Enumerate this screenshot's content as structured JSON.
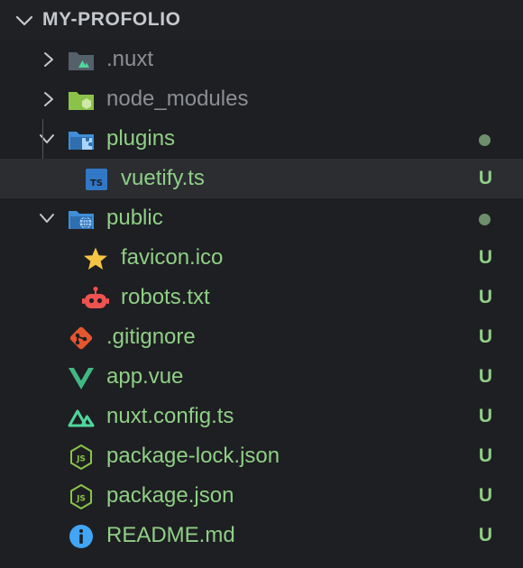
{
  "explorer": {
    "section_title": "MY-PROFOLIO"
  },
  "colors": {
    "background": "#1e1f22",
    "untracked_green": "#8fcf86",
    "ignored_gray": "#8b8e93",
    "selected_row": "#2b2d31"
  },
  "tree": {
    "items": [
      {
        "label": ".nuxt",
        "type": "folder",
        "expanded": false,
        "icon": "nuxt-folder-icon",
        "status": ""
      },
      {
        "label": "node_modules",
        "type": "folder",
        "expanded": false,
        "icon": "node-folder-icon",
        "status": ""
      },
      {
        "label": "plugins",
        "type": "folder",
        "expanded": true,
        "icon": "plugins-folder-icon",
        "status": "modified-dot"
      },
      {
        "label": "vuetify.ts",
        "type": "file",
        "icon": "typescript-icon",
        "status": "U",
        "selected": true
      },
      {
        "label": "public",
        "type": "folder",
        "expanded": true,
        "icon": "public-folder-icon",
        "status": "modified-dot"
      },
      {
        "label": "favicon.ico",
        "type": "file",
        "icon": "star-icon",
        "status": "U"
      },
      {
        "label": "robots.txt",
        "type": "file",
        "icon": "robot-icon",
        "status": "U"
      },
      {
        "label": ".gitignore",
        "type": "file",
        "icon": "git-icon",
        "status": "U"
      },
      {
        "label": "app.vue",
        "type": "file",
        "icon": "vue-icon",
        "status": "U"
      },
      {
        "label": "nuxt.config.ts",
        "type": "file",
        "icon": "nuxt-icon",
        "status": "U"
      },
      {
        "label": "package-lock.json",
        "type": "file",
        "icon": "json-icon",
        "status": "U"
      },
      {
        "label": "package.json",
        "type": "file",
        "icon": "json-icon",
        "status": "U"
      },
      {
        "label": "README.md",
        "type": "file",
        "icon": "info-icon",
        "status": "U"
      }
    ]
  }
}
